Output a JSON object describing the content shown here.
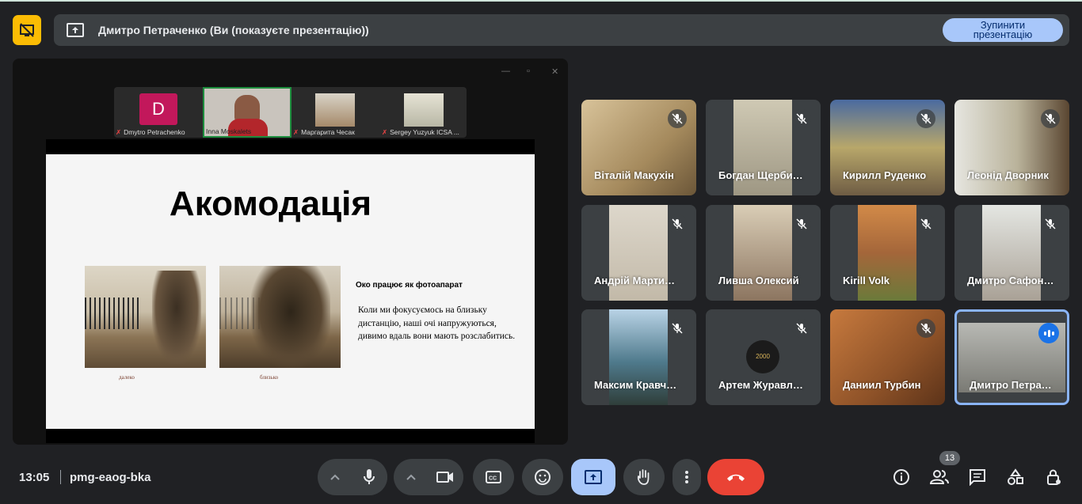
{
  "banner": {
    "presenter_text": "Дмитро Петраченко (Ви (показуєте презентацію))",
    "stop_line1": "Зупинити",
    "stop_line2": "презентацію"
  },
  "shared_window": {
    "thumbnails": [
      {
        "name": "Dmytro Petrachenko",
        "initial": "D"
      },
      {
        "name": "Inna Moskalets"
      },
      {
        "name": "Маргарита Чесак"
      },
      {
        "name": "Sergey Yuzyuk ICSA ..."
      }
    ],
    "slide": {
      "title": "Акомодація",
      "caption_left": "далеко",
      "caption_right": "близько",
      "subheading": "Око працює як фотоапарат",
      "body": "Коли ми фокусуємось на близьку дистанцію, наші очі напружуються, дивимо вдаль вони мають розслабитись."
    }
  },
  "participants": [
    {
      "name": "Віталій Макухін",
      "muted": true
    },
    {
      "name": "Богдан Щерби…",
      "muted": true
    },
    {
      "name": "Кирилл Руденко",
      "muted": true
    },
    {
      "name": "Леонід Дворник",
      "muted": true
    },
    {
      "name": "Андрій Марти…",
      "muted": true
    },
    {
      "name": "Ливша Олексий",
      "muted": true
    },
    {
      "name": "Kirill Volk",
      "muted": true
    },
    {
      "name": "Дмитро Сафон…",
      "muted": true
    },
    {
      "name": "Максим Кравч…",
      "muted": true
    },
    {
      "name": "Артем Журавл…",
      "muted": true,
      "avatar_text": "2000"
    },
    {
      "name": "Даниил Турбин",
      "muted": true
    },
    {
      "name": "Дмитро Петра…",
      "muted": false,
      "speaking": true
    }
  ],
  "bottom_bar": {
    "time": "13:05",
    "meeting_code": "pmg-eaog-bka",
    "people_count": "13"
  },
  "colors": {
    "background": "#202124",
    "tile": "#3c4043",
    "accent": "#8ab4f8",
    "present_button": "#a8c7fa",
    "end_call": "#ea4335",
    "presenting_icon": "#fbbc04"
  }
}
